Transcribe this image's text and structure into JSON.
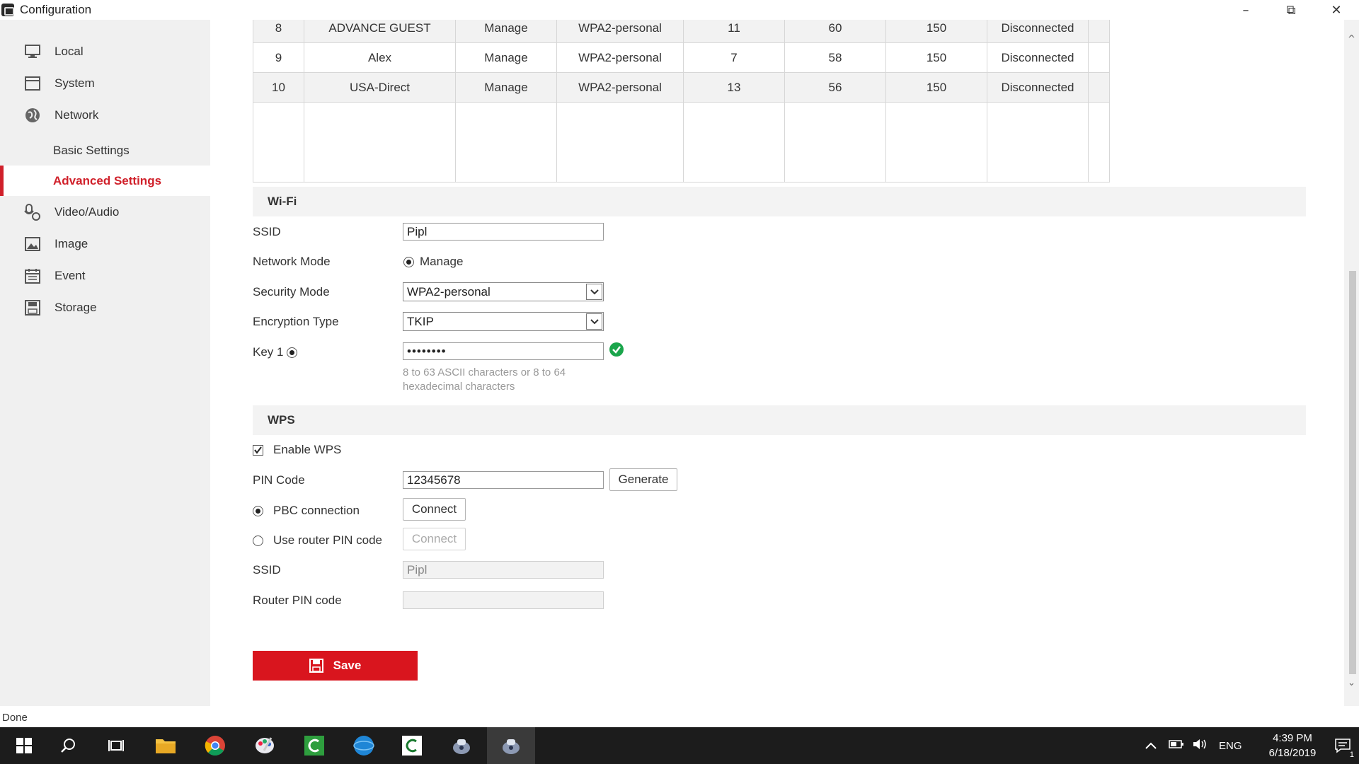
{
  "window": {
    "title": "Configuration"
  },
  "sidebar": {
    "items": [
      {
        "label": "Local",
        "icon": "monitor-icon"
      },
      {
        "label": "System",
        "icon": "system-icon"
      },
      {
        "label": "Network",
        "icon": "globe-icon"
      },
      {
        "label": "Video/Audio",
        "icon": "mic-camera-icon"
      },
      {
        "label": "Image",
        "icon": "image-icon"
      },
      {
        "label": "Event",
        "icon": "calendar-icon"
      },
      {
        "label": "Storage",
        "icon": "disk-icon"
      }
    ],
    "subitems": [
      {
        "label": "Basic Settings"
      },
      {
        "label": "Advanced Settings",
        "active": true
      }
    ]
  },
  "wifi_table": {
    "rows": [
      [
        "8",
        "ADVANCE GUEST",
        "Manage",
        "WPA2-personal",
        "11",
        "60",
        "150",
        "Disconnected"
      ],
      [
        "9",
        "Alex",
        "Manage",
        "WPA2-personal",
        "7",
        "58",
        "150",
        "Disconnected"
      ],
      [
        "10",
        "USA-Direct",
        "Manage",
        "WPA2-personal",
        "13",
        "56",
        "150",
        "Disconnected"
      ]
    ]
  },
  "wifi": {
    "section_title": "Wi-Fi",
    "ssid_label": "SSID",
    "ssid_value": "Pipl",
    "network_mode_label": "Network Mode",
    "network_mode_value": "Manage",
    "security_mode_label": "Security Mode",
    "security_mode_value": "WPA2-personal",
    "encryption_label": "Encryption Type",
    "encryption_value": "TKIP",
    "key_label": "Key 1",
    "key_value": "••••••••",
    "key_hint_line1": "8 to 63 ASCII characters or 8 to 64",
    "key_hint_line2": "hexadecimal characters"
  },
  "wps": {
    "section_title": "WPS",
    "enable_label": "Enable WPS",
    "enable_checked": true,
    "pin_label": "PIN Code",
    "pin_value": "12345678",
    "generate_label": "Generate",
    "pbc_label": "PBC connection",
    "pbc_connect_label": "Connect",
    "router_pin_option_label": "Use router PIN code",
    "router_connect_label": "Connect",
    "ssid_label": "SSID",
    "ssid_value": "Pipl",
    "router_pin_label": "Router PIN code",
    "router_pin_value": ""
  },
  "actions": {
    "save_label": "Save"
  },
  "status": {
    "text": "Done"
  },
  "taskbar": {
    "language": "ENG",
    "time": "4:39 PM",
    "date": "6/18/2019",
    "notification_count": "1"
  },
  "colors": {
    "accent": "#d9151e",
    "valid": "#1aa54b"
  }
}
